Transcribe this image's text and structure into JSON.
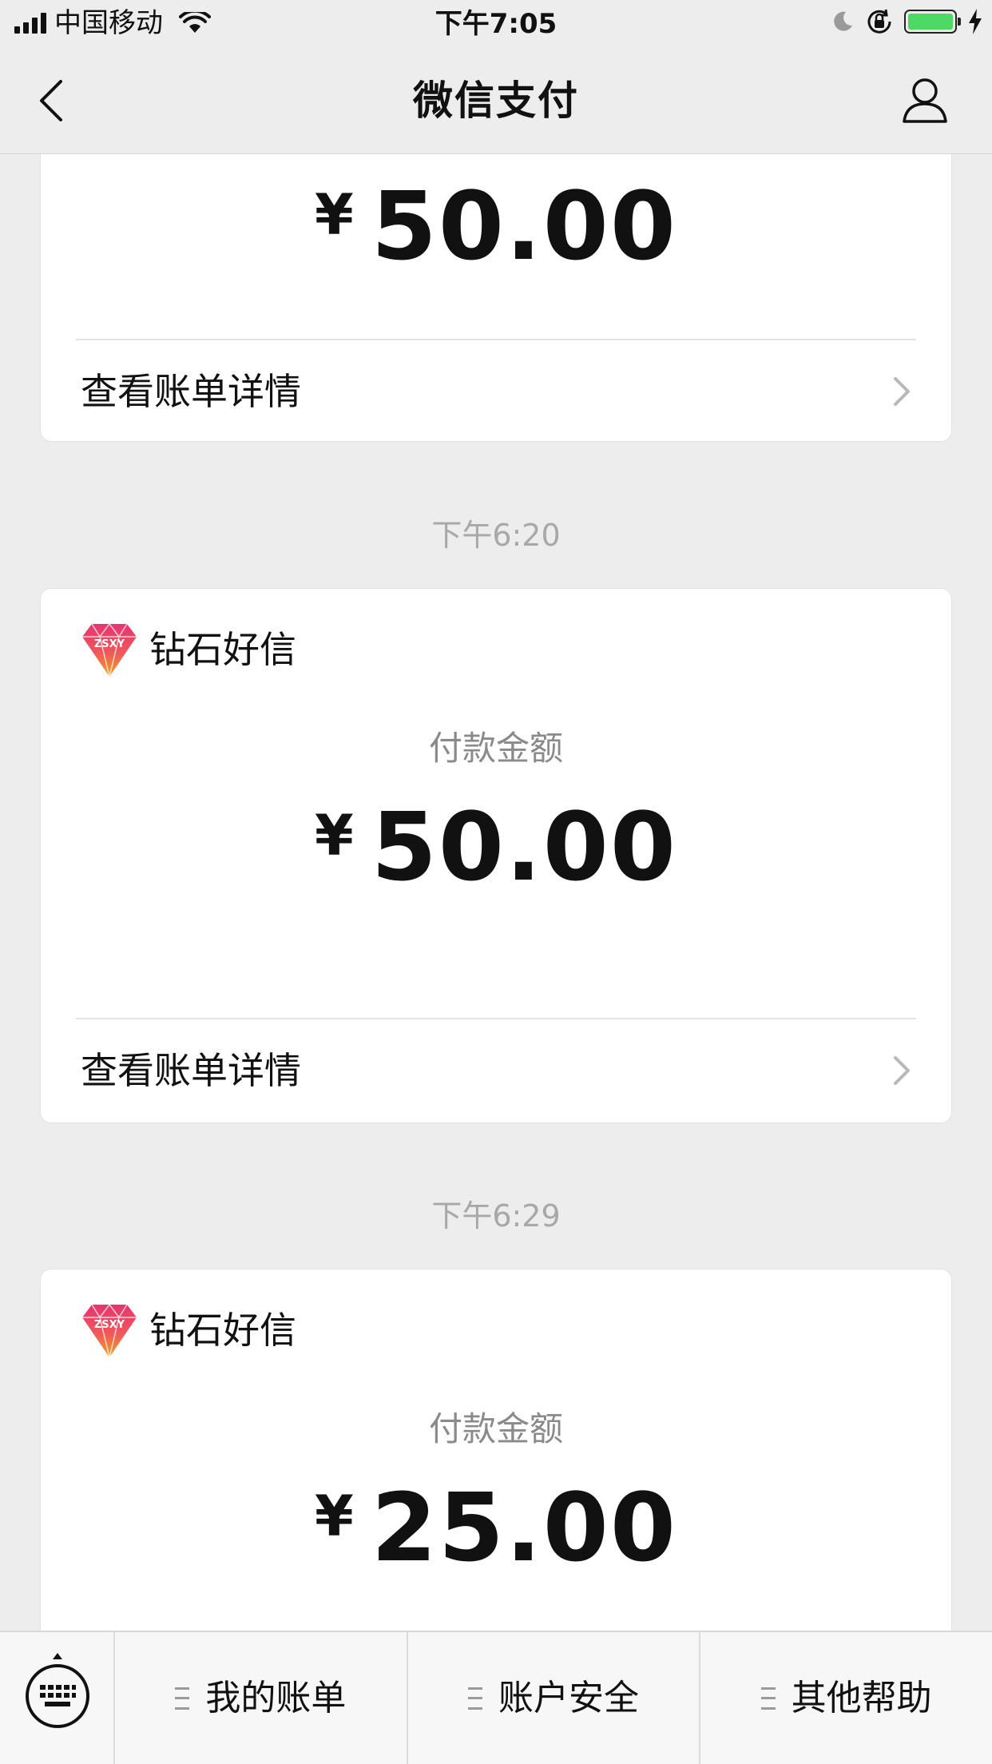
{
  "status_bar": {
    "carrier": "中国移动",
    "time": "下午7:05",
    "battery_level": 1.0,
    "battery_color": "#4cd964"
  },
  "nav": {
    "title": "微信支付",
    "back_icon": "chevron-left-icon",
    "profile_icon": "user-icon"
  },
  "cards": [
    {
      "amount_symbol": "¥",
      "amount": "50.00",
      "detail_label": "查看账单详情"
    },
    {
      "timestamp": "下午6:20",
      "merchant": "钻石好信",
      "amount_label": "付款金额",
      "amount_symbol": "¥",
      "amount": "50.00",
      "detail_label": "查看账单详情"
    },
    {
      "timestamp": "下午6:29",
      "merchant": "钻石好信",
      "amount_label": "付款金额",
      "amount_symbol": "¥",
      "amount": "25.00"
    }
  ],
  "logo_text": "ZSXY",
  "toolbar": {
    "keyboard_icon": "keyboard-icon",
    "items": [
      {
        "label": "我的账单"
      },
      {
        "label": "账户安全"
      },
      {
        "label": "其他帮助"
      }
    ]
  }
}
